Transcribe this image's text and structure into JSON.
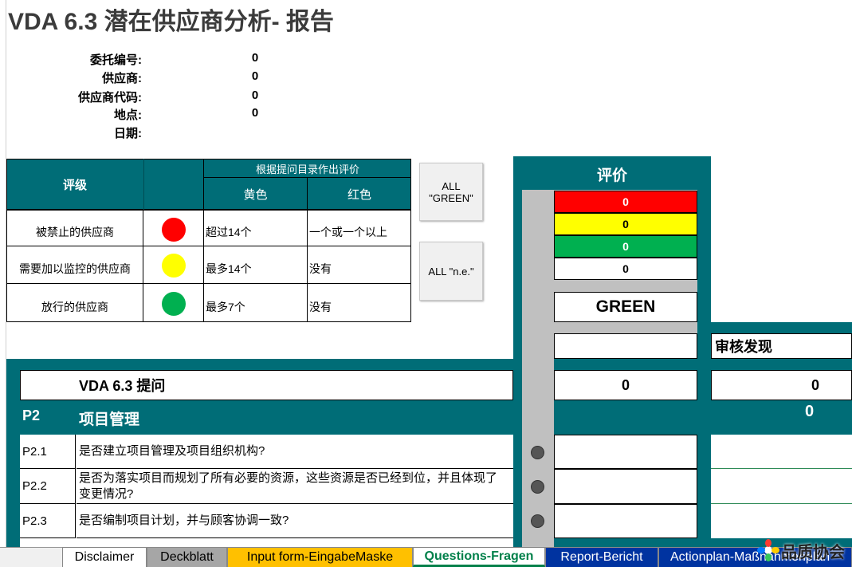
{
  "title": "VDA 6.3 潜在供应商分析- 报告",
  "meta": [
    {
      "label": "委托编号:",
      "value": "0"
    },
    {
      "label": "供应商:",
      "value": "0"
    },
    {
      "label": "供应商代码:",
      "value": "0"
    },
    {
      "label": "地点:",
      "value": "0"
    },
    {
      "label": "日期:",
      "value": ""
    }
  ],
  "rating_table": {
    "header_rating": "评级",
    "header_eval": "根据提问目录作出评价",
    "col_yellow": "黄色",
    "col_red": "红色",
    "rows": [
      {
        "label": "被禁止的供应商",
        "color": "#ff0000",
        "yellow": "超过14个",
        "red": "一个或一个以上"
      },
      {
        "label": "需要加以监控的供应商",
        "color": "#ffff00",
        "yellow": "最多14个",
        "red": "没有"
      },
      {
        "label": "放行的供应商",
        "color": "#00b050",
        "yellow": "最多7个",
        "red": "没有"
      }
    ]
  },
  "buttons": {
    "all_green": "ALL \"GREEN\"",
    "all_ne": "ALL \"n.e.\""
  },
  "evaluation": {
    "title": "评价",
    "red_count": "0",
    "yellow_count": "0",
    "green_count": "0",
    "white_count": "0",
    "result": "GREEN",
    "colors": {
      "red": "#ff0000",
      "yellow": "#ffff00",
      "green": "#00b050"
    }
  },
  "audit_findings": "审核发现",
  "vda_header": {
    "label": "VDA 6.3 提问",
    "score": "0",
    "findings": "0"
  },
  "section": {
    "id": "P2",
    "label": "项目管理",
    "findings": "0"
  },
  "questions": [
    {
      "id": "P2.1",
      "text": "是否建立项目管理及项目组织机构?"
    },
    {
      "id": "P2.2",
      "text": "是否为落实项目而规划了所有必要的资源，这些资源是否已经到位，并且体现了变更情况?"
    },
    {
      "id": "P2.3",
      "text": "是否编制项目计划，并与顾客协调一致?"
    }
  ],
  "sheet_tabs": [
    {
      "label": "Disclaimer",
      "color": "#ffffff",
      "text": "#000000"
    },
    {
      "label": "Deckblatt",
      "color": "#a6a6a6",
      "text": "#000000"
    },
    {
      "label": "Input form-EingabeMaske",
      "color": "#ffc000",
      "text": "#000000"
    },
    {
      "label": "Questions-Fragen",
      "color": "#ffffff",
      "text": "#00804a"
    },
    {
      "label": "Report-Bericht",
      "color": "#0033a0",
      "text": "#ffffff"
    },
    {
      "label": "Actionplan-Maßnahmenplan",
      "color": "#0033a0",
      "text": "#ffffff"
    }
  ],
  "watermark": "品质协会"
}
